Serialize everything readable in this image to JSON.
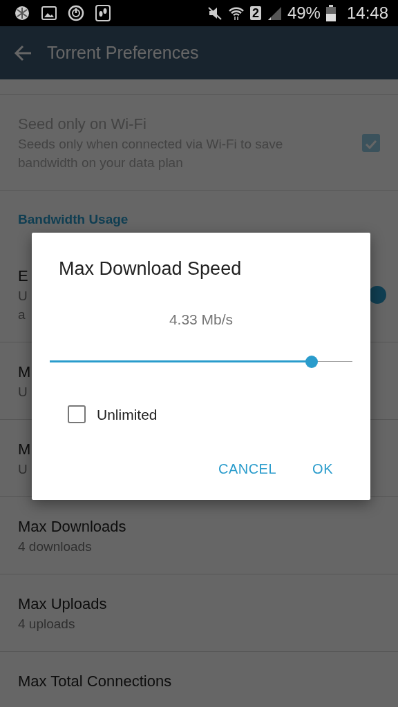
{
  "status_bar": {
    "sim": "2",
    "battery": "49%",
    "time": "14:48"
  },
  "app_bar": {
    "title": "Torrent Preferences"
  },
  "settings": [
    {
      "kind": "checkbox",
      "title": "Seed only on Wi-Fi",
      "summary_lines": [
        "Seeds only when connected via Wi-Fi to save",
        "bandwidth on your data plan"
      ],
      "checked": true,
      "disabled": true
    },
    {
      "kind": "header",
      "title": "Bandwidth Usage"
    },
    {
      "kind": "switch",
      "title": "E",
      "summary_lines": [
        "U",
        "a"
      ],
      "on": true,
      "disabled": false
    },
    {
      "kind": "value",
      "title": "M",
      "summary_lines": [
        "U"
      ],
      "disabled": false
    },
    {
      "kind": "value",
      "title": "M",
      "summary_lines": [
        "U"
      ],
      "disabled": false
    },
    {
      "kind": "value",
      "title": "Max Downloads",
      "summary_lines": [
        "4 downloads"
      ],
      "disabled": false
    },
    {
      "kind": "value",
      "title": "Max Uploads",
      "summary_lines": [
        "4 uploads"
      ],
      "disabled": false
    },
    {
      "kind": "value",
      "title": "Max Total Connections",
      "disabled": false
    }
  ],
  "dialog": {
    "title": "Max Download Speed",
    "reading": "4.33 Mb/s",
    "level": 0.865,
    "unlimited": {
      "label": "Unlimited",
      "checked": false
    },
    "buttons": [
      "CANCEL",
      "OK"
    ]
  }
}
